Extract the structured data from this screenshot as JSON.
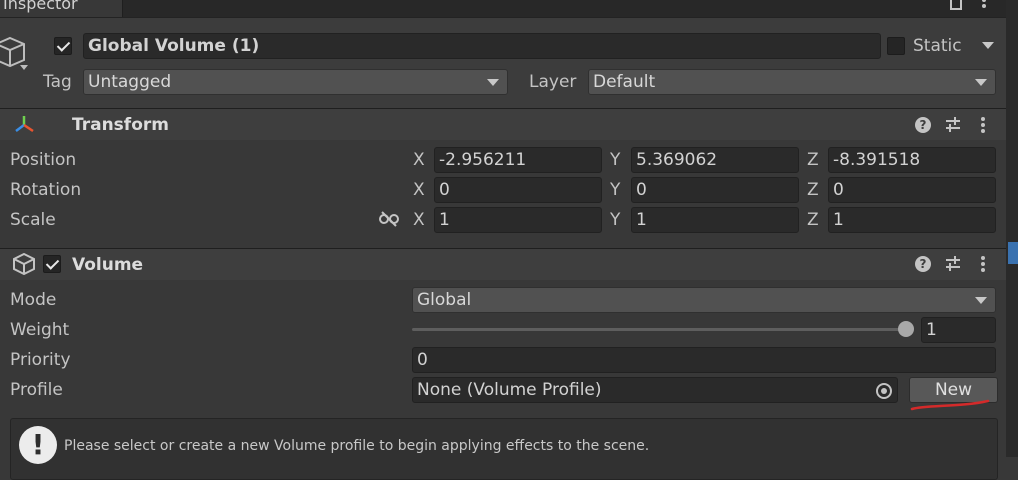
{
  "tab": {
    "title": "Inspector"
  },
  "object": {
    "name": "Global Volume (1)",
    "static_label": "Static",
    "tag_label": "Tag",
    "tag_value": "Untagged",
    "layer_label": "Layer",
    "layer_value": "Default"
  },
  "transform": {
    "title": "Transform",
    "rows": [
      {
        "label": "Position",
        "x": "-2.956211",
        "y": "5.369062",
        "z": "-8.391518"
      },
      {
        "label": "Rotation",
        "x": "0",
        "y": "0",
        "z": "0"
      },
      {
        "label": "Scale",
        "x": "1",
        "y": "1",
        "z": "1"
      }
    ],
    "axes": {
      "x": "X",
      "y": "Y",
      "z": "Z"
    }
  },
  "volume": {
    "title": "Volume",
    "mode_label": "Mode",
    "mode_value": "Global",
    "weight_label": "Weight",
    "weight_value": "1",
    "weight_fraction": 1.0,
    "priority_label": "Priority",
    "priority_value": "0",
    "profile_label": "Profile",
    "profile_value": "None (Volume Profile)",
    "new_button": "New",
    "help_message": "Please select or create a new Volume profile to begin applying effects to the scene."
  },
  "colors": {
    "background": "#383838",
    "field": "#2a2a2a",
    "annotation_red": "#d42a2a"
  },
  "icons": [
    "gameobject-icon",
    "transform-icon",
    "volume-icon",
    "help-icon",
    "preset-icon",
    "more-icon",
    "unlink-icon",
    "object-picker-icon",
    "warning-icon",
    "lock-icon"
  ]
}
